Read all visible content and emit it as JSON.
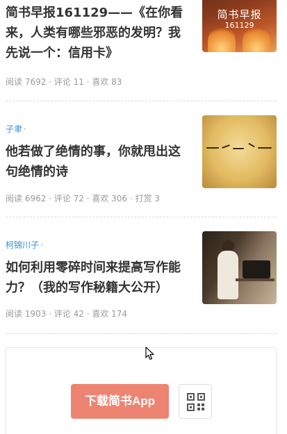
{
  "articles": [
    {
      "author": "",
      "title": "简书早报161129——《在你看来，人类有哪些邪恶的发明？我先说一个：信用卡》",
      "title_lines": [
        "简书早报161129——《在你看",
        "来，人类有哪些邪恶的发明？我",
        "先说一个：信用卡》"
      ],
      "meta": "阅读 7692 · 评论 11 · 喜欢 83",
      "thumb": {
        "title": "简书早报",
        "subtitle": "161129",
        "icon": "newspaper-cover-image"
      }
    },
    {
      "author": "子聿",
      "title_lines": [
        "他若做了绝情的事，你就甩出这",
        "句绝情的诗"
      ],
      "meta": "阅读 6962 · 评论 72 · 喜欢 306 · 打赏 3",
      "thumb": {
        "icon": "calligraphy-paper-image"
      }
    },
    {
      "author": "柯锦川子",
      "title_lines": [
        "如何利用零碎时间来提高写作能",
        "力？（我的写作秘籍大公开）"
      ],
      "meta": "阅读 1903 · 评论 42 · 喜欢 174",
      "thumb": {
        "icon": "typewriter-photo-image"
      }
    }
  ],
  "separator": "·",
  "download": {
    "label": "下载简书App",
    "color": "#ea6f5a",
    "qr_icon": "qr-code-icon"
  },
  "colors": {
    "author": "#3194d0",
    "meta": "#999999",
    "title": "#333333"
  }
}
